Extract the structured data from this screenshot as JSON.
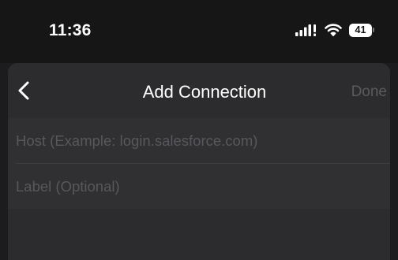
{
  "status_bar": {
    "time": "11:36",
    "battery": "41",
    "icons": [
      "signal-icon",
      "wifi-icon",
      "battery-icon"
    ]
  },
  "nav": {
    "back_icon": "chevron-left-icon",
    "title": "Add Connection",
    "done_label": "Done"
  },
  "form": {
    "host_value": "",
    "host_placeholder": "Host (Example: login.salesforce.com)",
    "label_value": "",
    "label_placeholder": "Label (Optional)"
  },
  "colors": {
    "background": "#1c1c1e",
    "sheet": "#2c2c2e",
    "done_disabled": "#5a5a5d",
    "placeholder": "#58585c"
  }
}
